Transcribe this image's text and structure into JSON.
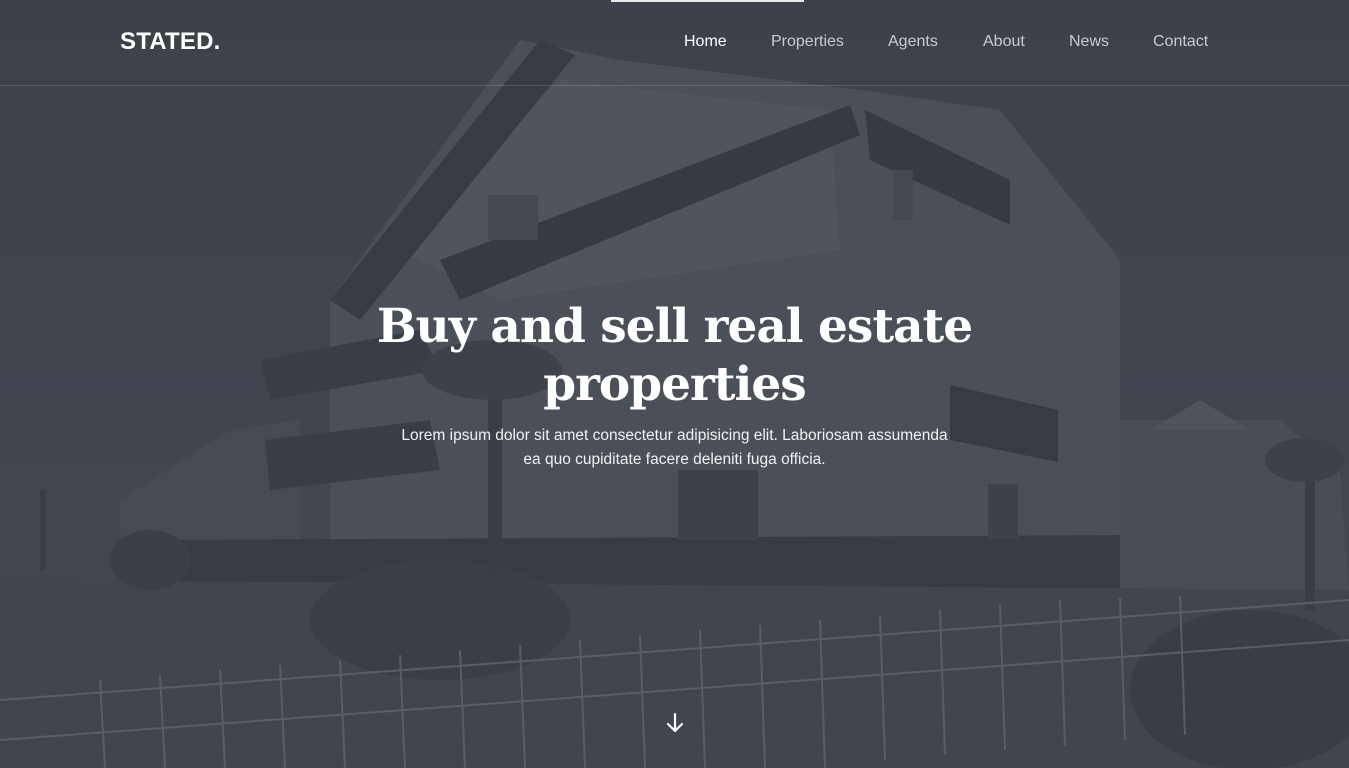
{
  "brand": {
    "logo_text": "STATED."
  },
  "nav": {
    "items": [
      {
        "label": "Home",
        "active": true
      },
      {
        "label": "Properties",
        "active": false
      },
      {
        "label": "Agents",
        "active": false
      },
      {
        "label": "About",
        "active": false
      },
      {
        "label": "News",
        "active": false
      },
      {
        "label": "Contact",
        "active": false
      }
    ]
  },
  "hero": {
    "headline_line1": "Buy and sell real estate",
    "headline_line2": "properties",
    "subtext": "Lorem ipsum dolor sit amet consectetur adipisicing elit. Laboriosam assumenda ea quo cupiditate facere deleniti fuga officia.",
    "scroll_icon": "arrow-down-icon"
  },
  "colors": {
    "background": "#3e424b",
    "nav_text": "#c9cbd0",
    "nav_active": "#ffffff"
  }
}
